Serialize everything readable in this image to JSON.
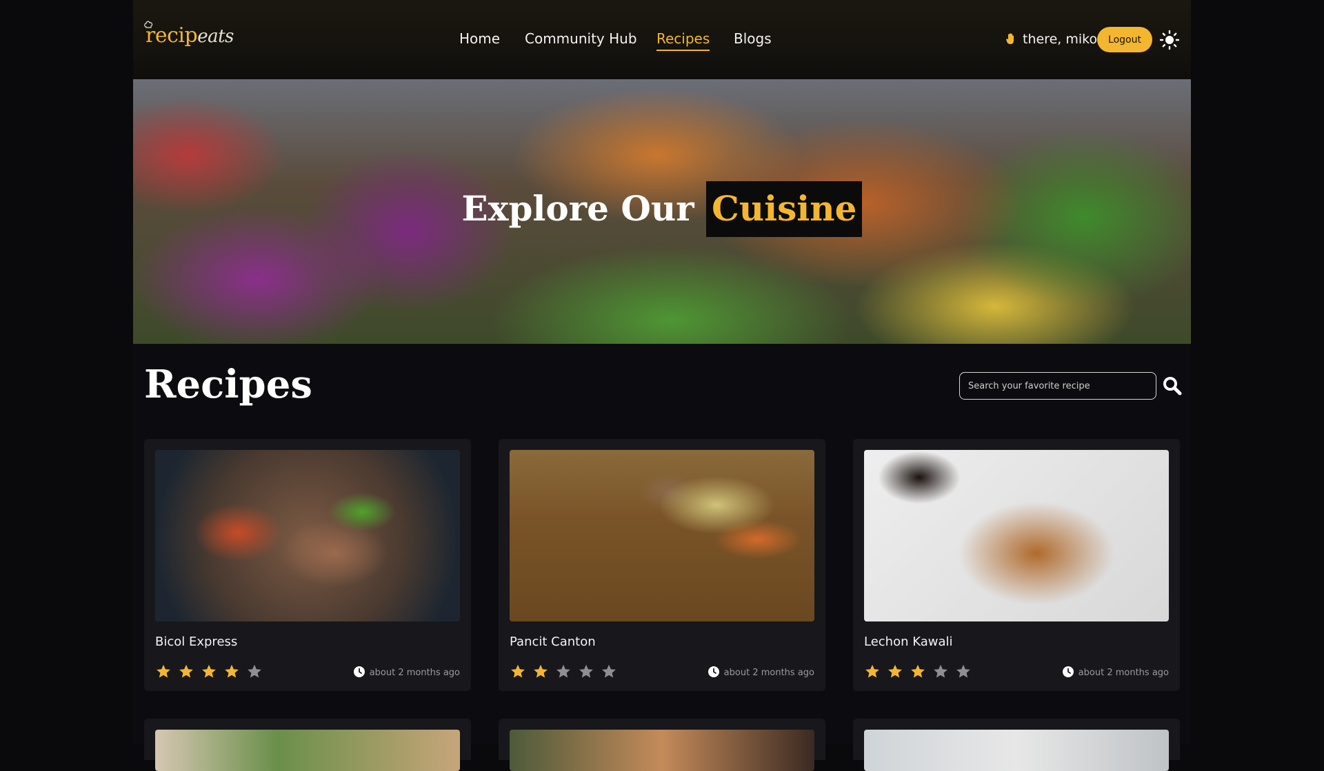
{
  "header": {
    "logo": {
      "main": "recip",
      "accent": "eats"
    },
    "nav": [
      {
        "label": "Home",
        "active": false
      },
      {
        "label": "Community Hub",
        "active": false
      },
      {
        "label": "Recipes",
        "active": true
      },
      {
        "label": "Blogs",
        "active": false
      }
    ],
    "greeting": "there, miko",
    "logout_label": "Logout",
    "theme_icon": "sun-icon"
  },
  "hero": {
    "title_plain": "Explore Our ",
    "title_highlight": "Cuisine"
  },
  "main": {
    "title": "Recipes",
    "search": {
      "placeholder": "Search your favorite recipe",
      "value": ""
    },
    "cards": [
      {
        "name": "Bicol Express",
        "rating": 4,
        "max_rating": 5,
        "time": "about 2 months ago"
      },
      {
        "name": "Pancit Canton",
        "rating": 2,
        "max_rating": 5,
        "time": "about 2 months ago"
      },
      {
        "name": "Lechon Kawali",
        "rating": 3,
        "max_rating": 5,
        "time": "about 2 months ago"
      }
    ]
  },
  "colors": {
    "accent": "#f4b62f",
    "star_filled": "#f4b62f",
    "star_empty": "#8e8e93",
    "card_bg": "#17171c"
  }
}
